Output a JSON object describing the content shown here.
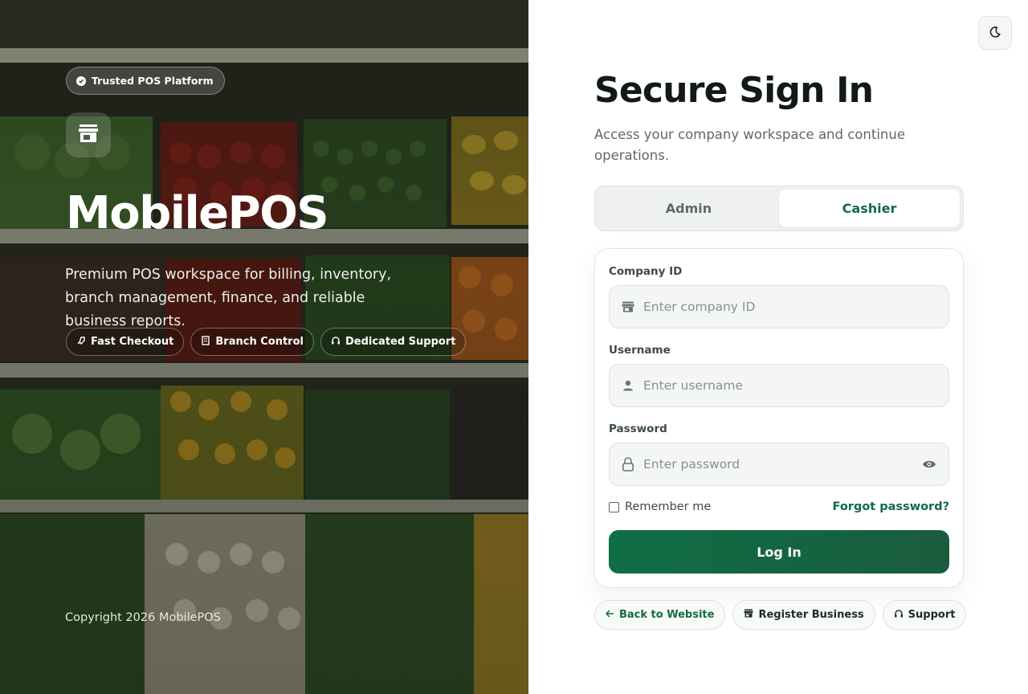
{
  "hero": {
    "badge": "Trusted POS Platform",
    "brand": "MobilePOS",
    "description": "Premium POS workspace for billing, inventory, branch management, finance, and reliable business reports.",
    "features": [
      {
        "label": "Fast Checkout",
        "icon": "rocket-icon"
      },
      {
        "label": "Branch Control",
        "icon": "building-icon"
      },
      {
        "label": "Dedicated Support",
        "icon": "headset-icon"
      }
    ],
    "copyright": "Copyright 2026 MobilePOS"
  },
  "signin": {
    "title": "Secure Sign In",
    "subtitle": "Access your company workspace and continue operations.",
    "tabs": [
      {
        "label": "Admin",
        "active": false
      },
      {
        "label": "Cashier",
        "active": true
      }
    ],
    "fields": {
      "company": {
        "label": "Company ID",
        "placeholder": "Enter company ID",
        "value": ""
      },
      "username": {
        "label": "Username",
        "placeholder": "Enter username",
        "value": ""
      },
      "password": {
        "label": "Password",
        "placeholder": "Enter password",
        "value": ""
      }
    },
    "remember_label": "Remember me",
    "remember_checked": false,
    "forgot_label": "Forgot password?",
    "login_label": "Log In"
  },
  "footer_links": [
    {
      "label": "Back to Website",
      "icon": "arrow-left-icon"
    },
    {
      "label": "Register Business",
      "icon": "store-icon"
    },
    {
      "label": "Support",
      "icon": "headset-icon"
    }
  ],
  "theme": {
    "toggle_icon": "moon-icon"
  },
  "colors": {
    "accent": "#116b45",
    "accent_dark": "#1a5c3e",
    "text": "#111a15",
    "muted": "#5d6b63"
  }
}
